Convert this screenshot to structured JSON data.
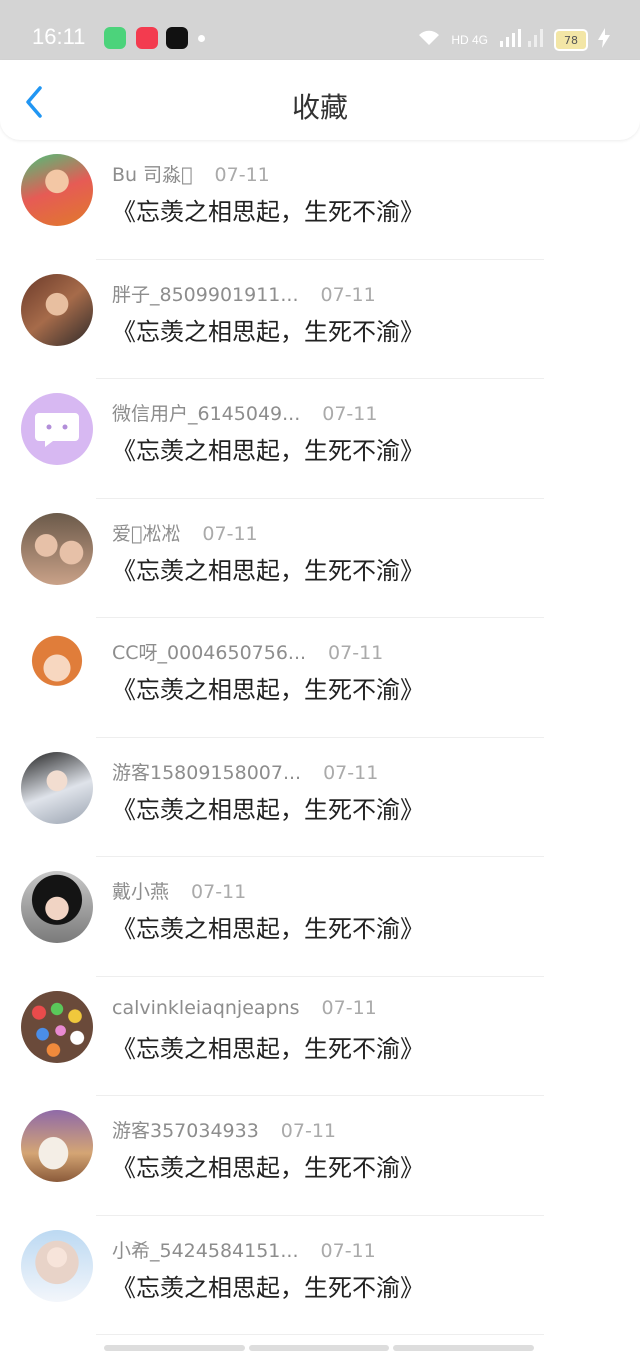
{
  "status_bar": {
    "time": "16:11",
    "network": "HD 4G",
    "battery": "78"
  },
  "header": {
    "title": "收藏"
  },
  "items": [
    {
      "name": "Bu 司淼\u0000",
      "date": "07-11",
      "message": "《忘羡之相思起，生死不渝》"
    },
    {
      "name": "胖子_8509901911...",
      "date": "07-11",
      "message": "《忘羡之相思起，生死不渝》"
    },
    {
      "name": "微信用户_6145049...",
      "date": "07-11",
      "message": "《忘羡之相思起，生死不渝》"
    },
    {
      "name": "爱\u0000凇凇",
      "date": "07-11",
      "message": "《忘羡之相思起，生死不渝》"
    },
    {
      "name": "CC呀_0004650756...",
      "date": "07-11",
      "message": "《忘羡之相思起，生死不渝》"
    },
    {
      "name": "游客15809158007...",
      "date": "07-11",
      "message": "《忘羡之相思起，生死不渝》"
    },
    {
      "name": "戴小燕",
      "date": "07-11",
      "message": "《忘羡之相思起，生死不渝》"
    },
    {
      "name": "calvinkleiaqnjeapns",
      "date": "07-11",
      "message": "《忘羡之相思起，生死不渝》"
    },
    {
      "name": "游客357034933",
      "date": "07-11",
      "message": "《忘羡之相思起，生死不渝》"
    },
    {
      "name": "小希_5424584151...",
      "date": "07-11",
      "message": "《忘羡之相思起，生死不渝》"
    }
  ],
  "colors": {
    "accent": "#2196f3"
  }
}
